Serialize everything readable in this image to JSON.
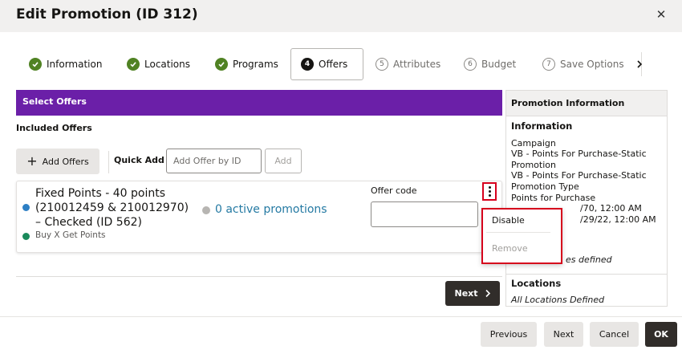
{
  "dialog": {
    "title": "Edit Promotion (ID 312)",
    "close_glyph": "✕"
  },
  "train": {
    "steps": [
      {
        "label": "Information",
        "status": "done",
        "icon": "check-icon"
      },
      {
        "label": "Locations",
        "status": "done",
        "icon": "check-icon"
      },
      {
        "label": "Programs",
        "status": "done",
        "icon": "check-icon"
      },
      {
        "label": "Offers",
        "number": "4",
        "status": "current"
      },
      {
        "label": "Attributes",
        "number": "5",
        "status": "todo"
      },
      {
        "label": "Budget",
        "number": "6",
        "status": "todo"
      },
      {
        "label": "Save Options",
        "number": "7",
        "status": "todo"
      }
    ],
    "next_glyph": "›"
  },
  "select_offers": {
    "header": "Select Offers",
    "included_label": "Included Offers",
    "add_offers_label": "Add Offers",
    "add_offers_glyph": "+",
    "quick_add_label": "Quick Add",
    "quick_add_placeholder": "Add Offer by ID",
    "quick_add_button": "Add"
  },
  "offer": {
    "name": "Fixed Points - 40 points (210012459 & 210012970) – Checked (ID 562)",
    "type": "Buy X Get Points",
    "active_promotions": "0 active promotions",
    "offer_code_label": "Offer code",
    "offer_code_value": ""
  },
  "context_menu": {
    "disable_label": "Disable",
    "remove_label": "Remove"
  },
  "panel_next_label": "Next",
  "promotion_info": {
    "header": "Promotion Information",
    "information_title": "Information",
    "lines": [
      "Campaign",
      "VB - Points For Purchase-Static Promotion",
      "VB - Points For Purchase-Static Promotion Type",
      "Points for Purchase",
      "/70, 12:00 AM",
      "/29/22, 12:00 AM"
    ],
    "partial_defined": "es defined",
    "locations_title": "Locations",
    "locations_value": "All Locations Defined"
  },
  "footer": {
    "previous_label": "Previous",
    "next_label": "Next",
    "cancel_label": "Cancel",
    "ok_label": "OK"
  },
  "colors": {
    "accent_purple": "#6b1fa8",
    "done_green": "#508223",
    "link_blue": "#257aa3",
    "highlight_red": "#d6001c"
  }
}
